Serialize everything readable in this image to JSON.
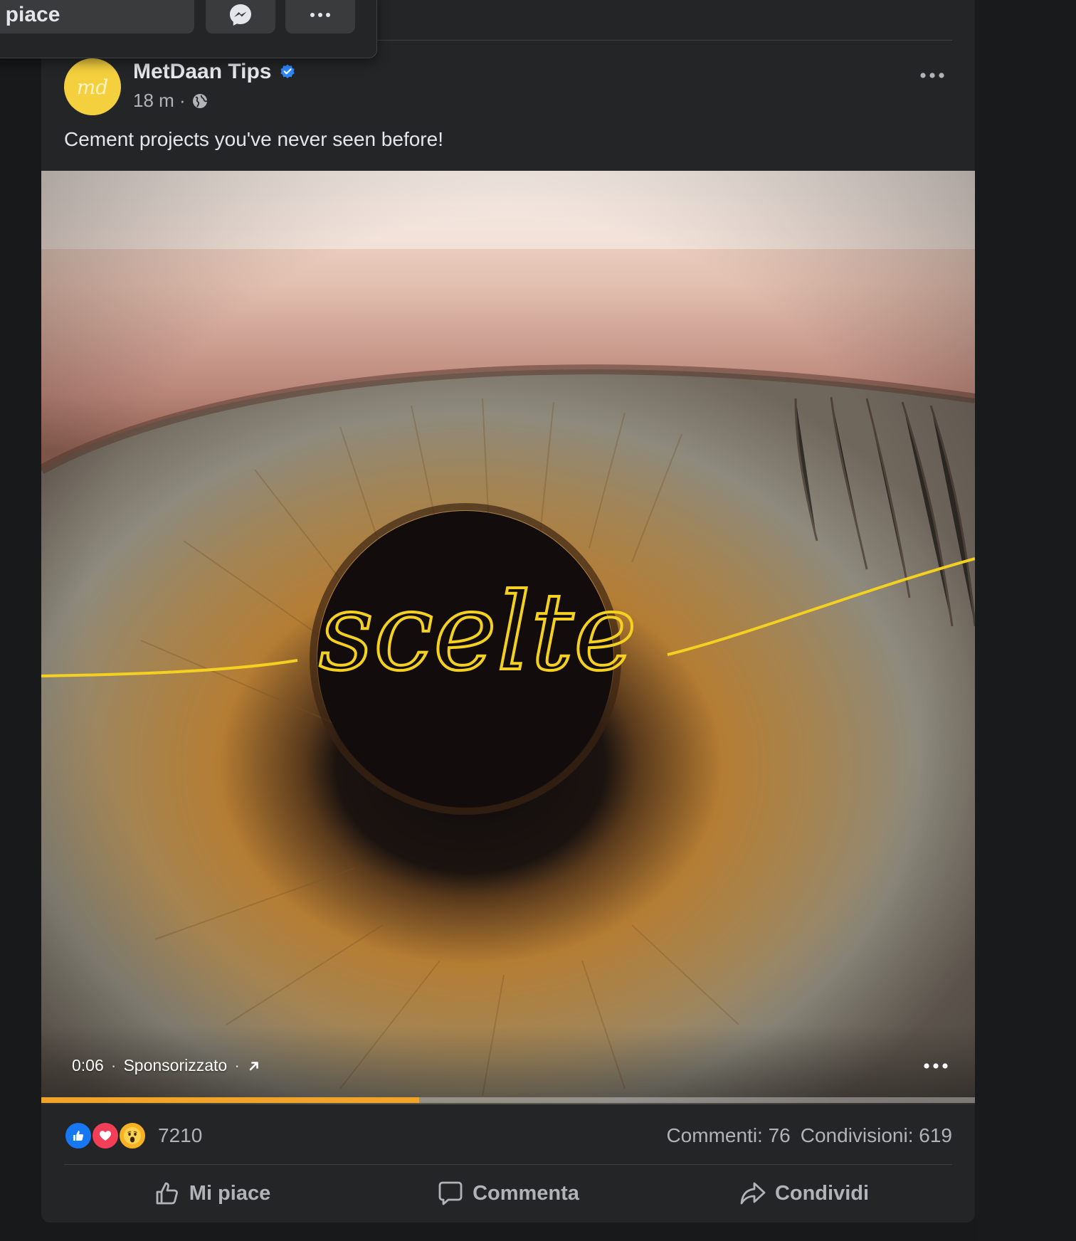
{
  "popup": {
    "like_label": "i piace",
    "messenger_icon": "messenger-icon",
    "more_icon": "more-horizontal-icon"
  },
  "post": {
    "page_name": "MetDaan Tips",
    "verified_icon": "verified-badge-icon",
    "avatar_text": "md",
    "avatar_color": "#f4d03f",
    "time": "18 m ·",
    "audience_icon": "globe-icon",
    "text": "Cement projects you've never seen before!"
  },
  "video": {
    "overlay_word": "scelte",
    "timestamp": "0:06",
    "separator": "·",
    "sponsored_label": "Sponsorizzato",
    "link_icon": "external-arrow-icon",
    "progress": 0.405,
    "progress_color": "#f0a52a"
  },
  "summary": {
    "reactions": [
      "like",
      "love",
      "wow"
    ],
    "reaction_count": "7210",
    "comments": "Commenti: 76",
    "shares": "Condivisioni: 619"
  },
  "actions": {
    "like": "Mi piace",
    "comment": "Commenta",
    "share": "Condividi"
  }
}
